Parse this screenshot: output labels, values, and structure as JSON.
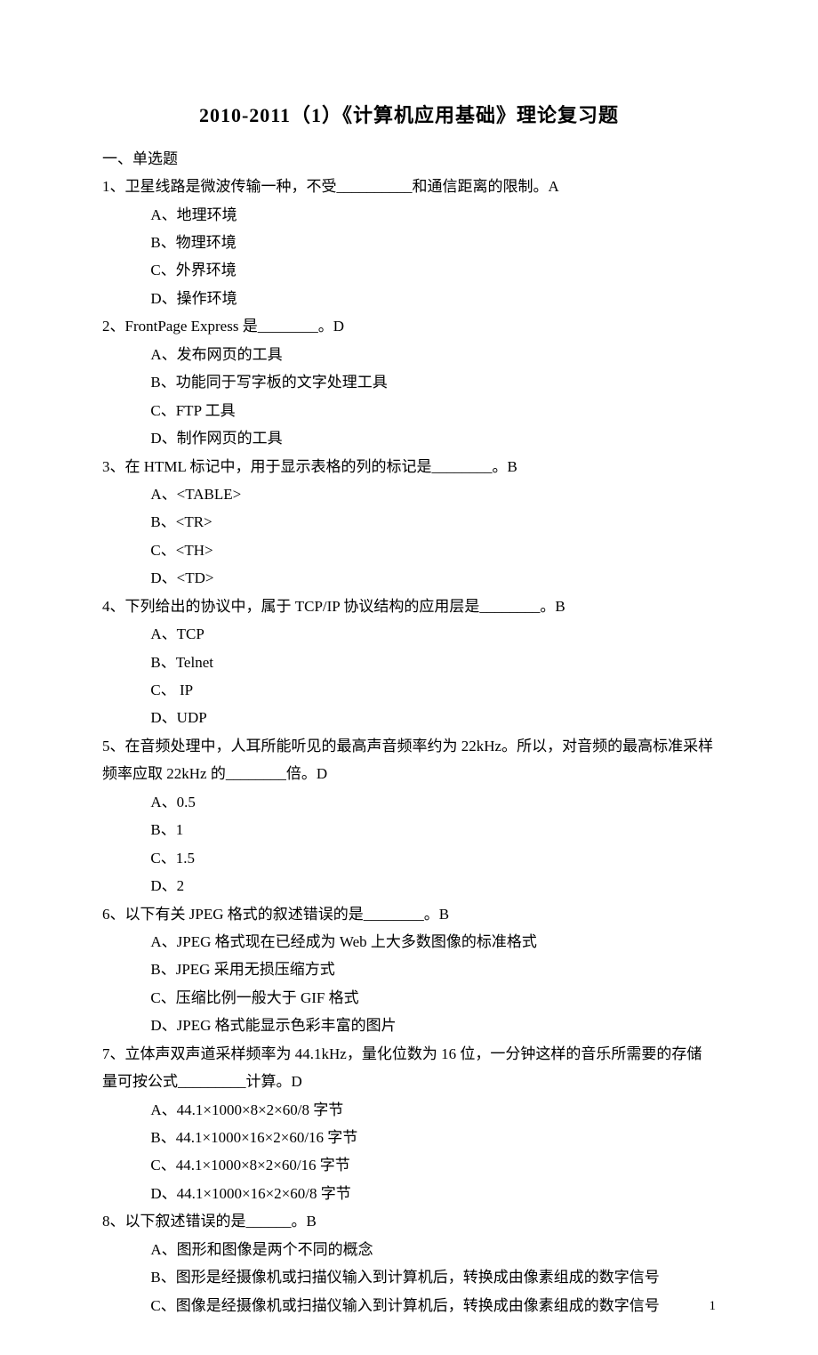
{
  "title": "2010-2011（1）《计算机应用基础》理论复习题",
  "sectionHead": "一、单选题",
  "questions": [
    {
      "stem": "1、卫星线路是微波传输一种，不受__________和通信距离的限制。A",
      "options": [
        "A、地理环境",
        "B、物理环境",
        "C、外界环境",
        "D、操作环境"
      ]
    },
    {
      "stem": "2、FrontPage Express 是________。D",
      "options": [
        "A、发布网页的工具",
        "B、功能同于写字板的文字处理工具",
        "C、FTP 工具",
        "D、制作网页的工具"
      ]
    },
    {
      "stem": "3、在 HTML 标记中，用于显示表格的列的标记是________。B",
      "options": [
        "A、<TABLE>",
        "B、<TR>",
        "C、<TH>",
        "D、<TD>"
      ]
    },
    {
      "stem": "4、下列给出的协议中，属于 TCP/IP 协议结构的应用层是________。B",
      "options": [
        "A、TCP",
        "B、Telnet",
        "C、 IP",
        "D、UDP"
      ]
    },
    {
      "stem": "5、在音频处理中，人耳所能听见的最高声音频率约为 22kHz。所以，对音频的最高标准采样频率应取 22kHz 的________倍。D",
      "options": [
        "A、0.5",
        "B、1",
        "C、1.5",
        "D、2"
      ]
    },
    {
      "stem": "6、以下有关 JPEG 格式的叙述错误的是________。B",
      "options": [
        "A、JPEG 格式现在已经成为 Web 上大多数图像的标准格式",
        "B、JPEG 采用无损压缩方式",
        "C、压缩比例一般大于 GIF 格式",
        "D、JPEG 格式能显示色彩丰富的图片"
      ]
    },
    {
      "stem": "7、立体声双声道采样频率为 44.1kHz，量化位数为 16 位，一分钟这样的音乐所需要的存储量可按公式_________计算。D",
      "options": [
        "A、44.1×1000×8×2×60/8 字节",
        "B、44.1×1000×16×2×60/16 字节",
        "C、44.1×1000×8×2×60/16 字节",
        "D、44.1×1000×16×2×60/8 字节"
      ]
    },
    {
      "stem": "8、以下叙述错误的是______。B",
      "options": [
        "A、图形和图像是两个不同的概念",
        "B、图形是经摄像机或扫描仪输入到计算机后，转换成由像素组成的数字信号",
        "C、图像是经摄像机或扫描仪输入到计算机后，转换成由像素组成的数字信号"
      ]
    }
  ],
  "pageNumber": "1"
}
